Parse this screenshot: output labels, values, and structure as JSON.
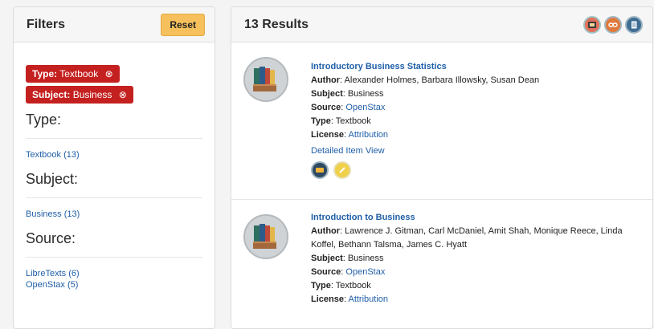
{
  "filters": {
    "title": "Filters",
    "reset_label": "Reset",
    "active": [
      {
        "key": "Type:",
        "value": "Textbook",
        "remove": "⊗"
      },
      {
        "key": "Subject:",
        "value": "Business",
        "remove": "⊗"
      }
    ],
    "facets": [
      {
        "title": "Type:",
        "options": [
          "Textbook (13)"
        ]
      },
      {
        "title": "Subject:",
        "options": [
          "Business (13)"
        ]
      },
      {
        "title": "Source:",
        "options": [
          "LibreTexts (6)",
          "OpenStax (5)"
        ]
      }
    ]
  },
  "results": {
    "title": "13 Results",
    "header_icons": [
      "photo-icon",
      "link-icon",
      "document-icon"
    ],
    "items": [
      {
        "title": "Introductory Business Statistics",
        "author_label": "Author",
        "author": ": Alexander Holmes, Barbara Illowsky, Susan Dean",
        "subject_label": "Subject",
        "subject": ": Business",
        "source_label": "Source",
        "source": "OpenStax",
        "type_label": "Type",
        "type": ": Textbook",
        "license_label": "License",
        "license": "Attribution",
        "detail_link": "Detailed Item View",
        "badges": [
          "ticket-icon",
          "pencil-icon"
        ]
      },
      {
        "title": "Introduction to Business",
        "author_label": "Author",
        "author": ": Lawrence J. Gitman, Carl McDaniel, Amit Shah, Monique Reece, Linda Koffel, Bethann Talsma, James C. Hyatt",
        "subject_label": "Subject",
        "subject": ": Business",
        "source_label": "Source",
        "source": "OpenStax",
        "type_label": "Type",
        "type": ": Textbook",
        "license_label": "License",
        "license": "Attribution"
      }
    ]
  }
}
